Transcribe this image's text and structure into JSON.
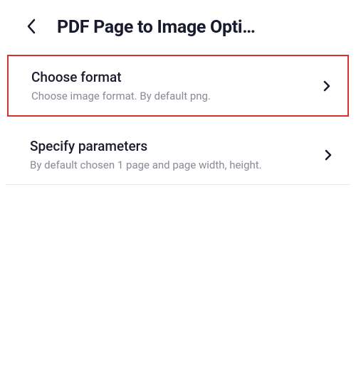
{
  "header": {
    "title": "PDF Page to Image Opti…"
  },
  "options": [
    {
      "title": "Choose format",
      "subtitle": "Choose image format. By default png.",
      "highlighted": true
    },
    {
      "title": "Specify parameters",
      "subtitle": "By default chosen 1 page and page width, height.",
      "highlighted": false
    }
  ]
}
